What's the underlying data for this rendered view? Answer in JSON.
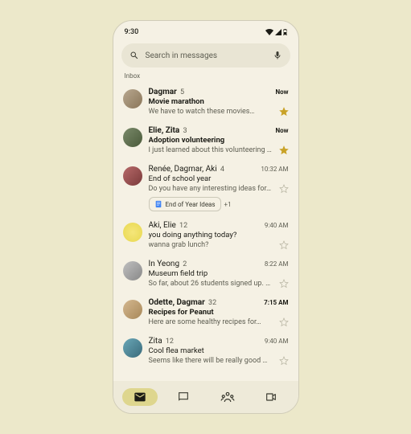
{
  "status": {
    "time": "9:30"
  },
  "search": {
    "placeholder": "Search in messages"
  },
  "section_label": "Inbox",
  "threads": [
    {
      "sender": "Dagmar",
      "count": "5",
      "time": "Now",
      "subject": "Movie marathon",
      "preview": "We have to watch these movies…",
      "unread": true,
      "starred": true,
      "avatar_bg": "linear-gradient(135deg,#b8a890,#8a7558)"
    },
    {
      "sender": "Elie, Zita",
      "count": "3",
      "time": "Now",
      "subject": "Adoption volunteering",
      "preview": "I just learned about this volunteering …",
      "unread": true,
      "starred": true,
      "avatar_bg": "linear-gradient(135deg,#7a8a6a,#4a5a3a)"
    },
    {
      "sender": "Renée, Dagmar, Aki",
      "count": "4",
      "time": "10:32 AM",
      "subject": "End of school year",
      "preview": "Do you have any interesting ideas for…",
      "unread": false,
      "starred": false,
      "avatar_bg": "linear-gradient(135deg,#b86a6a,#7a3a3a)",
      "attachment": {
        "label": "End of Year Ideas",
        "more": "+1"
      }
    },
    {
      "sender": "Aki, Elie",
      "count": "12",
      "time": "9:40 AM",
      "subject": "you doing anything today?",
      "preview": "wanna grab lunch?",
      "unread": false,
      "starred": false,
      "avatar_bg": "radial-gradient(circle,#f5e67a,#e8d850)"
    },
    {
      "sender": "In Yeong",
      "count": "2",
      "time": "8:22 AM",
      "subject": "Museum field trip",
      "preview": "So far, about 26 students signed up. …",
      "unread": false,
      "starred": false,
      "avatar_bg": "linear-gradient(135deg,#c0c0c0,#888888)"
    },
    {
      "sender": "Odette, Dagmar",
      "count": "32",
      "time": "7:15 AM",
      "subject": "Recipes for Peanut",
      "preview": "Here are some healthy recipes for…",
      "unread": true,
      "starred": false,
      "avatar_bg": "linear-gradient(135deg,#d4b890,#a88858)"
    },
    {
      "sender": "Zita",
      "count": "12",
      "time": "9:40 AM",
      "subject": "Cool flea market",
      "preview": "Seems like there will be really good …",
      "unread": false,
      "starred": false,
      "avatar_bg": "linear-gradient(135deg,#6aa8b8,#3a6a7a)"
    }
  ],
  "nav": {
    "items": [
      "mail",
      "chat",
      "meet-people",
      "video"
    ],
    "active": 0
  }
}
